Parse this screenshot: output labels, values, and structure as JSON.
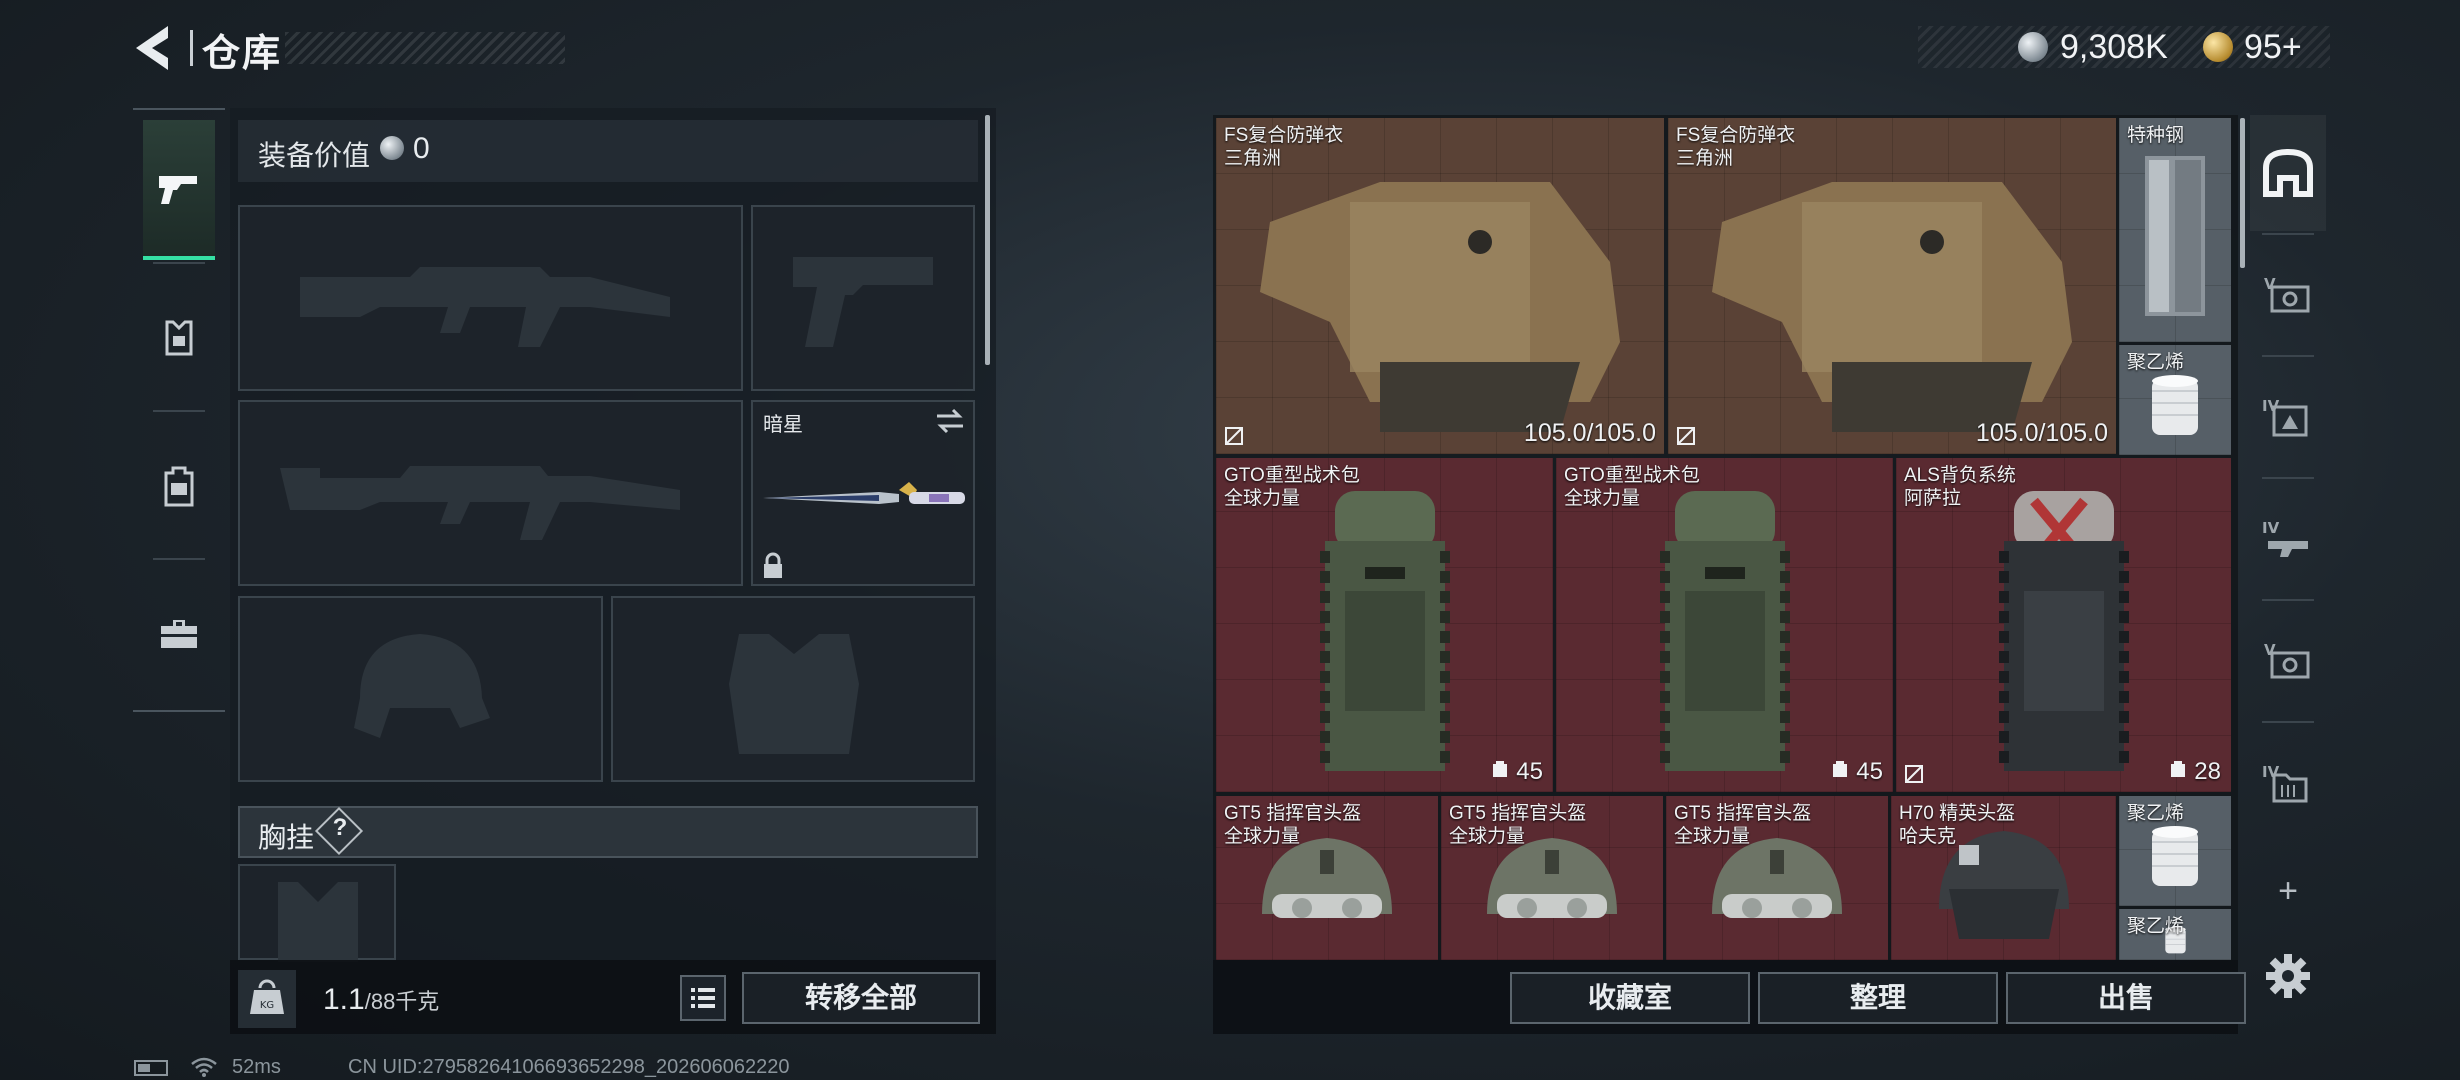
{
  "header": {
    "title": "仓库",
    "currency_primary": "9,308K",
    "currency_secondary": "95+"
  },
  "left_tabs": [
    {
      "name": "weapons",
      "icon": "pistol-icon",
      "active": true
    },
    {
      "name": "armor",
      "icon": "armor-plate-icon",
      "active": false
    },
    {
      "name": "backpack",
      "icon": "backpack-icon",
      "active": false
    },
    {
      "name": "toolbox",
      "icon": "toolbox-icon",
      "active": false
    }
  ],
  "loadout": {
    "equipment_value_label": "装备价值",
    "equipment_value": "0",
    "melee_name": "暗星",
    "chest_rig_label": "胸挂",
    "chest_help": "?",
    "weight_current": "1.1",
    "weight_max": "/88千克",
    "transfer_all": "转移全部"
  },
  "stash_items": [
    {
      "name": "FS复合防弹衣",
      "maker": "三角洲",
      "durability": "105.0/105.0",
      "color": "brown"
    },
    {
      "name": "FS复合防弹衣",
      "maker": "三角洲",
      "durability": "105.0/105.0",
      "color": "brown"
    },
    {
      "name": "特种钢",
      "maker": "",
      "color": "gray"
    },
    {
      "name": "聚乙烯",
      "maker": "",
      "color": "gray"
    },
    {
      "name": "GTO重型战术包",
      "maker": "全球力量",
      "capacity": "45",
      "color": "red"
    },
    {
      "name": "GTO重型战术包",
      "maker": "全球力量",
      "capacity": "45",
      "color": "red"
    },
    {
      "name": "ALS背负系统",
      "maker": "阿萨拉",
      "capacity": "28",
      "color": "red"
    },
    {
      "name": "GT5 指挥官头盔",
      "maker": "全球力量",
      "color": "red"
    },
    {
      "name": "GT5 指挥官头盔",
      "maker": "全球力量",
      "color": "red"
    },
    {
      "name": "GT5 指挥官头盔",
      "maker": "全球力量",
      "color": "red"
    },
    {
      "name": "H70 精英头盔",
      "maker": "哈夫克",
      "color": "red"
    },
    {
      "name": "聚乙烯",
      "maker": "",
      "color": "gray"
    },
    {
      "name": "聚乙烯",
      "maker": "",
      "color": "gray"
    }
  ],
  "stash_buttons": {
    "collection": "收藏室",
    "organize": "整理",
    "sell": "出售"
  },
  "right_tabs": [
    {
      "icon": "stash-home-icon",
      "active": true,
      "level": ""
    },
    {
      "icon": "container-v-icon",
      "level": "V"
    },
    {
      "icon": "container-iv-icon",
      "level": "IV"
    },
    {
      "icon": "container-iv-b-icon",
      "level": "IV"
    },
    {
      "icon": "container-v-b-icon",
      "level": "V"
    },
    {
      "icon": "container-iv-c-icon",
      "level": "IV"
    }
  ],
  "right_extra": {
    "add_label": "+"
  },
  "footer": {
    "ping": "52ms",
    "uid": "CN UID:2795826410669365229​8_202606062220"
  },
  "colors": {
    "accent_green": "#35e0a4",
    "cell_brown": "#5a4236",
    "cell_red": "#5a2a31",
    "cell_gray": "#565f67"
  }
}
